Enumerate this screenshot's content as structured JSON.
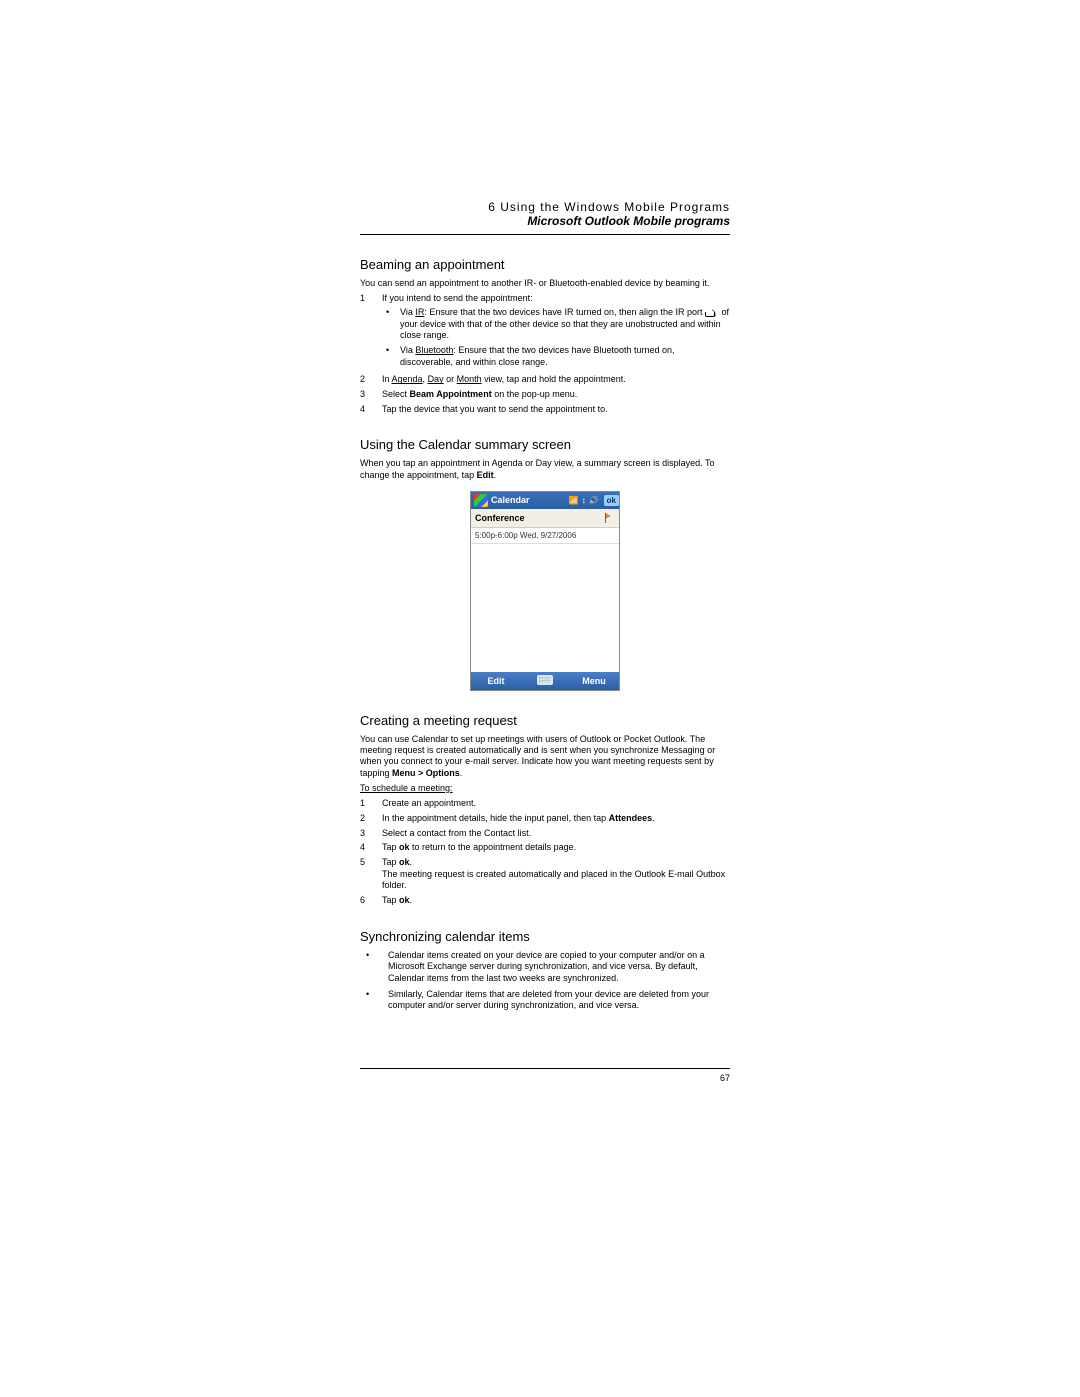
{
  "header": {
    "chapter": "6 Using the Windows Mobile Programs",
    "section": "Microsoft Outlook Mobile programs"
  },
  "sect_beam": {
    "title": "Beaming an appointment",
    "intro": "You can send an appointment to another IR- or Bluetooth-enabled device by beaming it.",
    "step1": "If you intend to send the appointment:",
    "via_ir_pre": "Via ",
    "via_ir_u": "IR",
    "via_ir_text_a": ": Ensure that the two devices have IR turned on, then align the IR port ",
    "via_ir_text_b": " of your device with that of the other device so that they are unobstructed and within close range.",
    "via_bt_pre": "Via ",
    "via_bt_u": "Bluetooth",
    "via_bt_text": ": Ensure that the two devices have Bluetooth turned on, discoverable, and within close range.",
    "step2_pre": "In ",
    "step2_u1": "Agenda",
    "step2_mid1": ", ",
    "step2_u2": "Day",
    "step2_mid2": " or ",
    "step2_u3": "Month",
    "step2_post": " view, tap and hold the appointment.",
    "step3_pre": "Select ",
    "step3_b": "Beam Appointment",
    "step3_post": " on the pop-up menu.",
    "step4": "Tap the device that you want to send the appointment to."
  },
  "sect_summary": {
    "title": "Using the Calendar summary screen",
    "intro_a": "When you tap an appointment in Agenda or Day view, a summary screen is displayed. To change the appointment, tap ",
    "intro_b": "Edit",
    "intro_c": "."
  },
  "figure": {
    "titlebar": "Calendar",
    "ok": "ok",
    "subject": "Conference",
    "datetime": "5:00p-6:00p Wed, 9/27/2006",
    "btn_edit": "Edit",
    "btn_menu": "Menu"
  },
  "sect_meeting": {
    "title": "Creating a meeting request",
    "intro_a": "You can use Calendar to set up meetings with users of Outlook or Pocket Outlook. The meeting request is created automatically and is sent when you synchronize Messaging or when you connect to your e-mail server. Indicate how you want meeting requests sent by tapping ",
    "intro_b": "Menu > Options",
    "intro_c": ".",
    "sched_u": "To schedule a meeting:",
    "s1": "Create an appointment.",
    "s2_a": "In the appointment details, hide the input panel, then tap ",
    "s2_b": "Attendees",
    "s2_c": ".",
    "s3": "Select a contact from the Contact list.",
    "s4_a": "Tap ",
    "s4_b": "ok",
    "s4_c": " to return to the appointment details page.",
    "s5_a": "Tap ",
    "s5_b": "ok",
    "s5_c": ".",
    "s5_note": "The meeting request is created automatically and placed in the Outlook E-mail Outbox folder.",
    "s6_a": "Tap ",
    "s6_b": "ok",
    "s6_c": "."
  },
  "sect_sync": {
    "title": "Synchronizing calendar items",
    "b1": "Calendar items created on your device are copied to your computer and/or on a Microsoft Exchange server during synchronization, and vice versa. By default, Calendar items from the last two weeks are synchronized.",
    "b2": "Similarly, Calendar items that are deleted from your device are deleted from your computer and/or server during synchronization, and vice versa."
  },
  "page_number": "67"
}
